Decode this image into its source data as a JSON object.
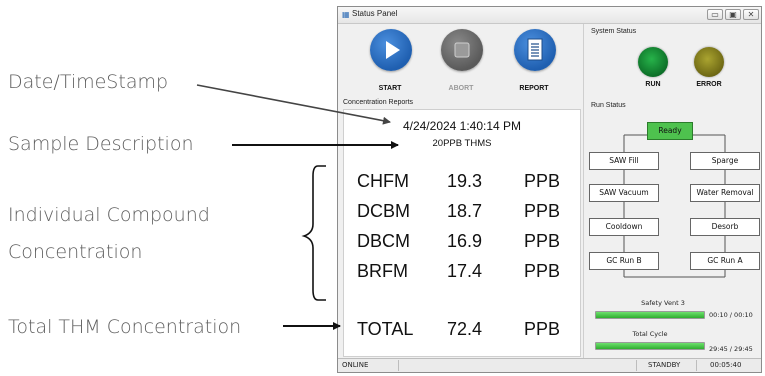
{
  "annotations": {
    "date_timestamp": "Date/TimeStamp",
    "sample_description": "Sample Description",
    "individual_line1": "Individual Compound",
    "individual_line2": "Concentration",
    "total_thm": "Total THM Concentration"
  },
  "window": {
    "title": "Status Panel",
    "controls": [
      "minimize",
      "maximize",
      "close"
    ]
  },
  "toolbar": {
    "start_label": "START",
    "abort_label": "ABORT",
    "report_label": "REPORT"
  },
  "concentration": {
    "group_label": "Concentration Reports",
    "timestamp": "4/24/2024 1:40:14 PM",
    "description": "20PPB THMS",
    "rows": [
      {
        "name": "CHFM",
        "value": "19.3",
        "unit": "PPB"
      },
      {
        "name": "DCBM",
        "value": "18.7",
        "unit": "PPB"
      },
      {
        "name": "DBCM",
        "value": "16.9",
        "unit": "PPB"
      },
      {
        "name": "BRFM",
        "value": "17.4",
        "unit": "PPB"
      }
    ],
    "total": {
      "name": "TOTAL",
      "value": "72.4",
      "unit": "PPB"
    }
  },
  "system_status": {
    "group_label": "System Status",
    "run_label": "RUN",
    "error_label": "ERROR",
    "colors": {
      "run": "#1a9a3c",
      "error": "#8c861e"
    }
  },
  "run_status": {
    "group_label": "Run Status",
    "ready": "Ready",
    "nodes": {
      "saw_fill": "SAW Fill",
      "sparge": "Sparge",
      "saw_vacuum": "SAW Vacuum",
      "water_removal": "Water Removal",
      "cooldown": "Cooldown",
      "desorb": "Desorb",
      "gc_run_b": "GC Run B",
      "gc_run_a": "GC Run A"
    },
    "safety_vent": {
      "label": "Safety Vent 3",
      "time": "00:10 / 00:10",
      "progress": 1.0
    },
    "total_cycle": {
      "label": "Total Cycle",
      "time": "29:45 / 29:45",
      "progress": 1.0
    }
  },
  "statusbar": {
    "left": "ONLINE",
    "middle": "STANDBY",
    "right": "00:05:40"
  }
}
